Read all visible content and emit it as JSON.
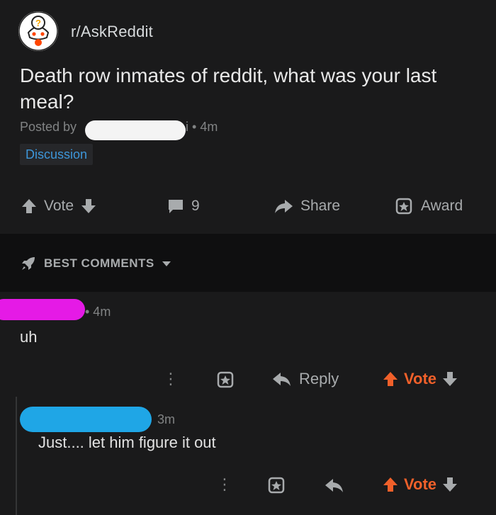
{
  "post": {
    "subreddit": "r/AskReddit",
    "title": "Death row inmates of reddit, what was your last meal?",
    "posted_by_label": "Posted by",
    "author_suffix": "i",
    "separator": "•",
    "age": "4m",
    "flair": "Discussion"
  },
  "actions": {
    "vote": "Vote",
    "comment_count": "9",
    "share": "Share",
    "award": "Award"
  },
  "sort": {
    "label": "BEST COMMENTS"
  },
  "comments": [
    {
      "age": "• 4m",
      "body": "uh",
      "reply": "Reply",
      "vote": "Vote"
    },
    {
      "age": "3m",
      "body": "Just.... let him figure it out",
      "vote": "Vote"
    }
  ],
  "colors": {
    "background": "#1a1a1b",
    "band": "#0f0f10",
    "muted": "#818384",
    "flair_text": "#3d96d9",
    "upvote": "#f0602a",
    "redact_white": "#f4f4f4",
    "redact_pink": "#e51ae6",
    "redact_blue": "#1fa6e6"
  },
  "icons": [
    "askreddit-avatar-icon",
    "upvote-arrow-icon",
    "downvote-arrow-icon",
    "comment-bubble-icon",
    "share-arrow-icon",
    "award-badge-icon",
    "rocket-icon",
    "caret-down-icon",
    "kebab-menu-icon",
    "reply-arrow-icon"
  ]
}
